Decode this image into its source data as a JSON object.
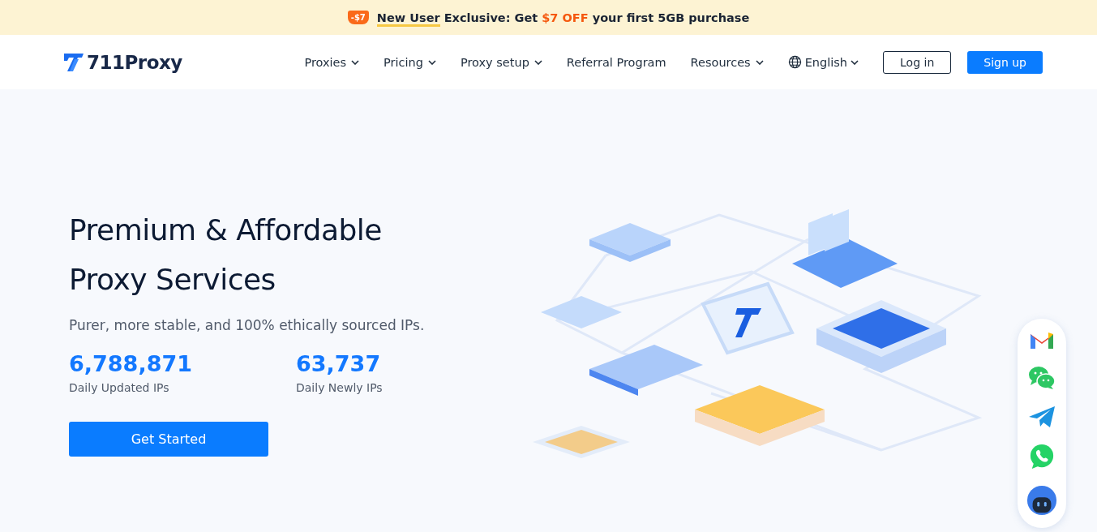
{
  "promo_banner": {
    "badge": "-$7",
    "parts": [
      {
        "text": "New User",
        "kind": "underlined"
      },
      {
        "text": " Exclusive: Get ",
        "kind": "plain"
      },
      {
        "text": "$7 OFF",
        "kind": "highlight"
      },
      {
        "text": " your first 5GB purchase",
        "kind": "plain"
      }
    ]
  },
  "header": {
    "logo": "711Proxy",
    "nav": [
      {
        "label": "Proxies",
        "has_menu": true
      },
      {
        "label": "Pricing",
        "has_menu": true
      },
      {
        "label": "Proxy setup",
        "has_menu": true
      },
      {
        "label": "Referral Program",
        "has_menu": false
      },
      {
        "label": "Resources",
        "has_menu": true
      }
    ],
    "language": "English",
    "login": "Log in",
    "signup": "Sign up"
  },
  "hero": {
    "title_lines": [
      "Premium & Affordable",
      "Proxy Services"
    ],
    "subtitle": "Purer, more stable, and 100% ethically sourced IPs.",
    "stats": [
      {
        "value": "6,788,871",
        "label": "Daily Updated IPs"
      },
      {
        "value": "63,737",
        "label": "Daily Newly IPs"
      }
    ],
    "cta": "Get Started"
  },
  "contact_bar": {
    "items": [
      {
        "kind": "mail"
      },
      {
        "kind": "chat"
      },
      {
        "kind": "telegram"
      },
      {
        "kind": "phone"
      },
      {
        "kind": "bot"
      }
    ]
  }
}
